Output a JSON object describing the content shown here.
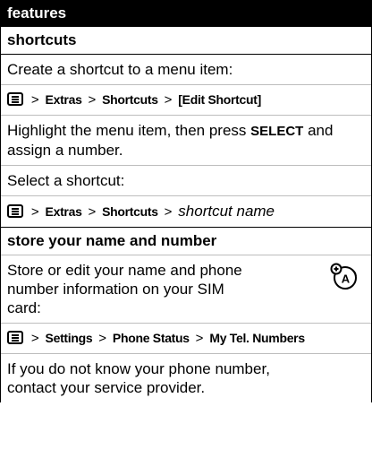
{
  "table": {
    "header": "features",
    "shortcuts": {
      "title": "shortcuts",
      "create_text": "Create a shortcut to a menu item:",
      "path1": {
        "extras": "Extras",
        "shortcuts": "Shortcuts",
        "edit": "[Edit Shortcut]"
      },
      "highlight_a": "Highlight the menu item, then press ",
      "select_key": "SELECT",
      "highlight_b": " and assign a number.",
      "select_text": "Select a shortcut:",
      "path2": {
        "extras": "Extras",
        "shortcuts": "Shortcuts",
        "name": "shortcut name"
      }
    },
    "store": {
      "title": "store your name and number",
      "line1": "Store or edit your name and phone",
      "line2": "number information on your SIM",
      "line3": "card:",
      "path": {
        "settings": "Settings",
        "status": "Phone Status",
        "numbers": "My Tel. Numbers"
      },
      "note_line1": "If you do not know your phone number,",
      "note_line2": "contact your service provider."
    }
  },
  "icons": {
    "menu_key": "menu-key-icon",
    "sim": "sim-card-icon",
    "separator": ">"
  }
}
